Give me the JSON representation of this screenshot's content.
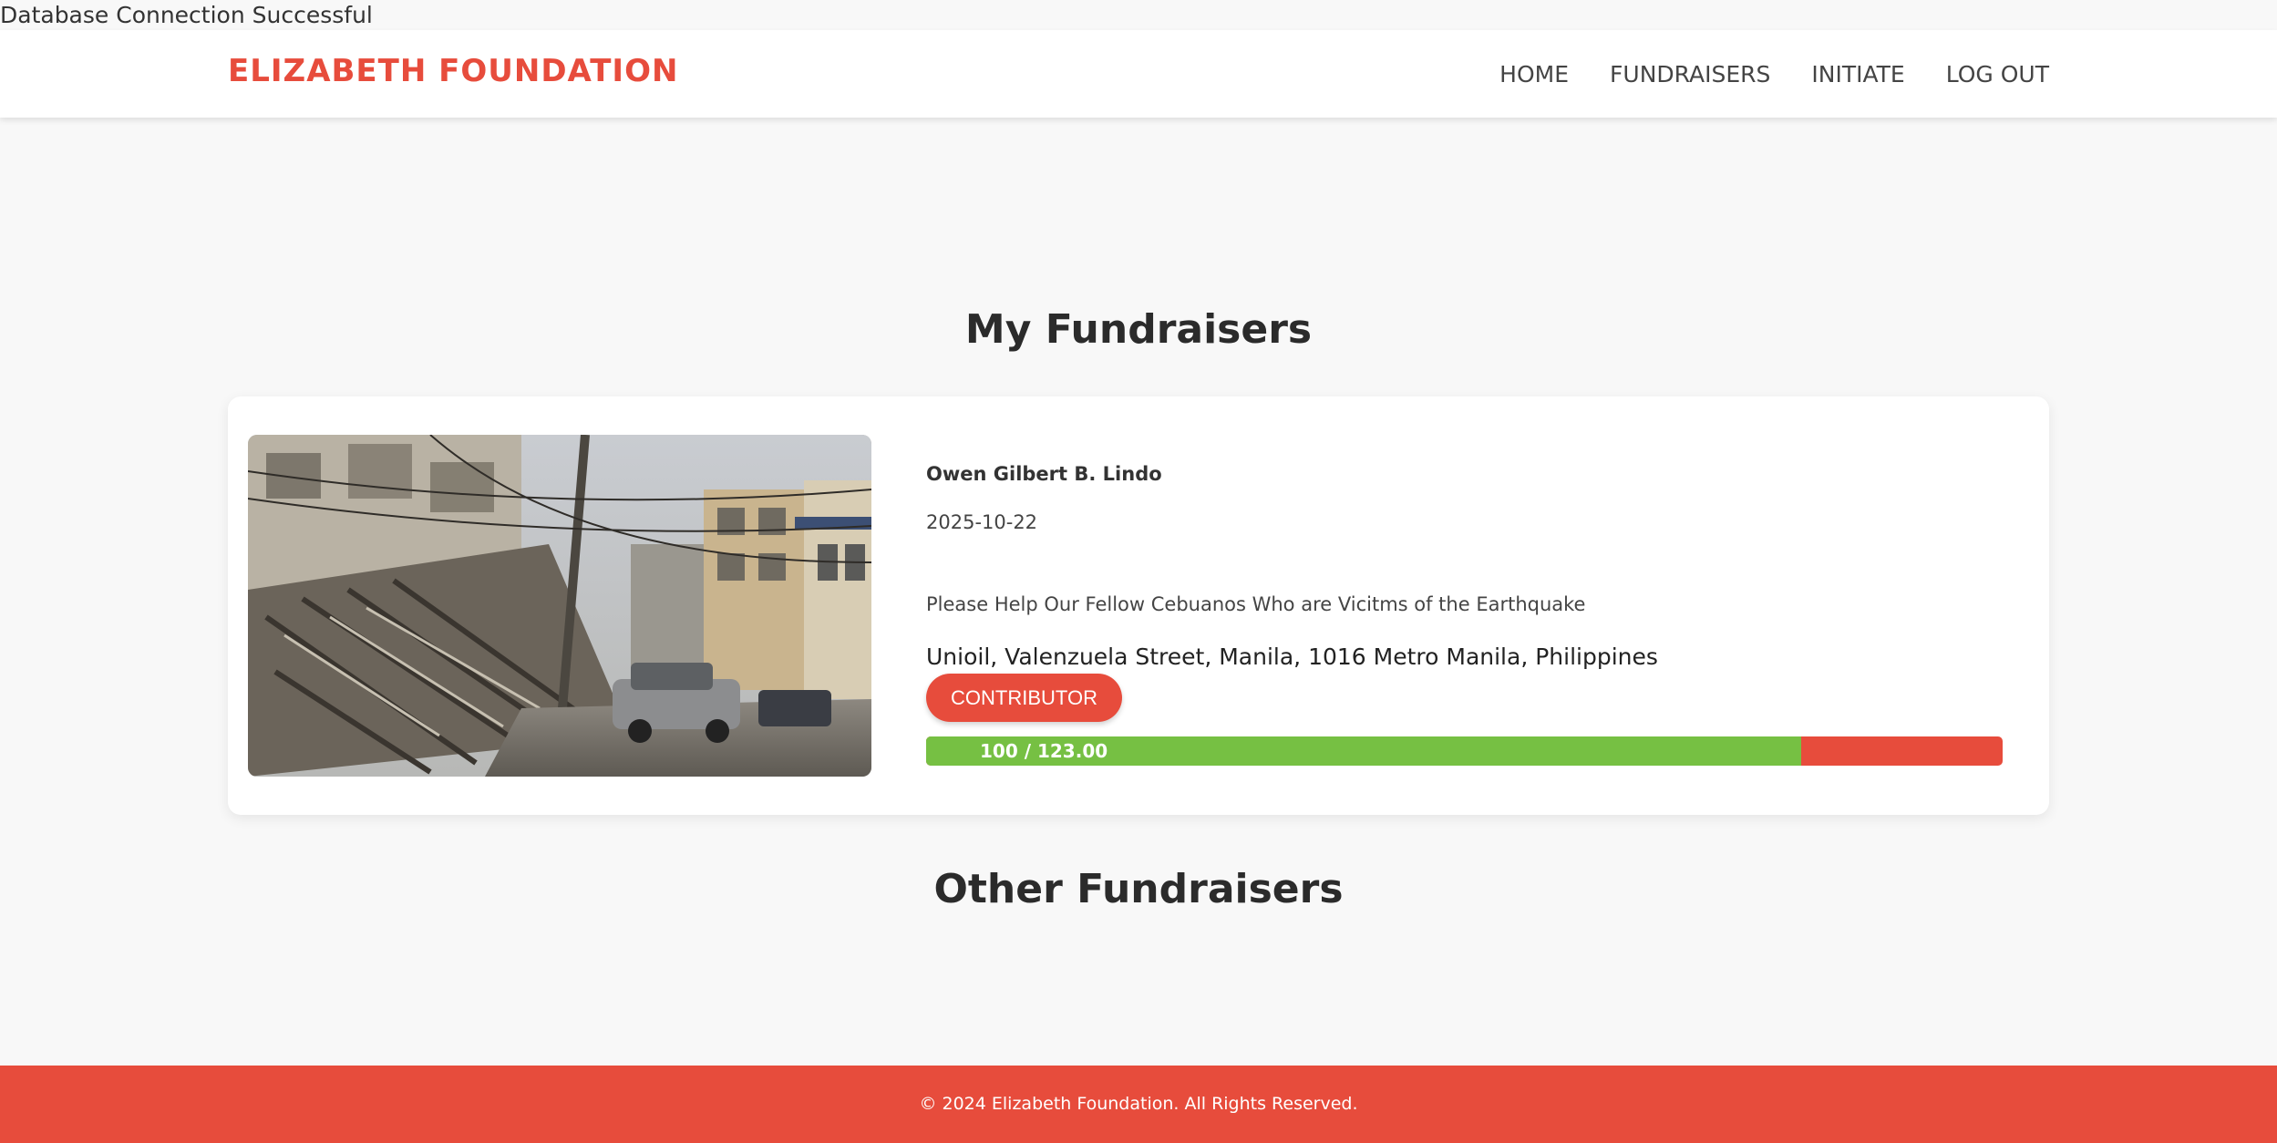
{
  "status_message": "Database Connection Successful",
  "header": {
    "brand": "ELIZABETH FOUNDATION",
    "nav": [
      "HOME",
      "FUNDRAISERS",
      "INITIATE",
      "LOG OUT"
    ]
  },
  "main": {
    "my_fundraisers_title": "My Fundraisers",
    "other_fundraisers_title": "Other Fundraisers",
    "fundraiser": {
      "organizer": "Owen Gilbert B. Lindo",
      "date": "2025-10-22",
      "description": "Please Help Our Fellow Cebuanos Who are Vicitms of the Earthquake",
      "location": "Unioil, Valenzuela Street, Manila, 1016 Metro Manila, Philippines",
      "button_label": "CONTRIBUTOR",
      "progress_label": "100 / 123.00",
      "progress_raised": 100,
      "progress_goal": 123.0,
      "image_subject": "earthquake-damaged-street-photo"
    }
  },
  "footer": {
    "text": "© 2024 Elizabeth Foundation. All Rights Reserved."
  },
  "colors": {
    "accent": "#e74c3c",
    "progress_fill": "#76c043",
    "background": "#f8f8f8"
  }
}
